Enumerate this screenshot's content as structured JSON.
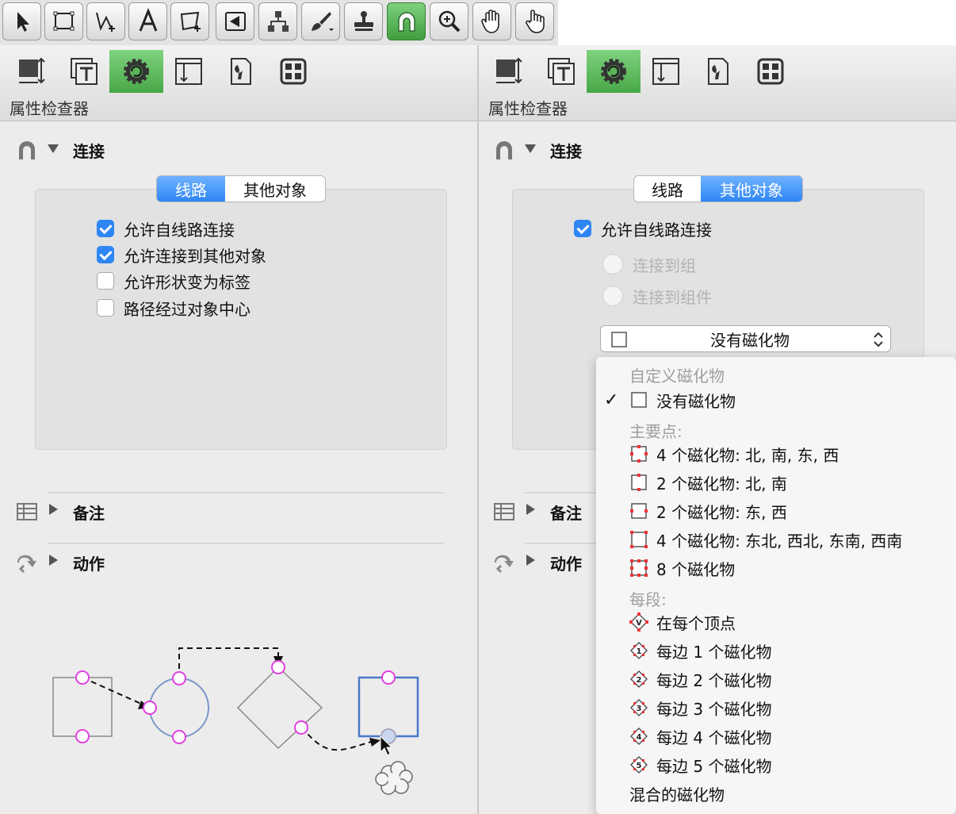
{
  "toolbar": {
    "tools": [
      "selection-tool",
      "rectangle-tool",
      "line-tool",
      "text-tool",
      "shape-tool",
      "arrow-tool",
      "diagram-tool",
      "style-brush-tool",
      "rubber-stamp-tool",
      "magnet-tool",
      "zoom-tool",
      "hand-tool",
      "browse-tool"
    ],
    "active": "magnet-tool"
  },
  "left": {
    "inspector_title": "属性检查器",
    "connect_section": "连接",
    "tabs": [
      "线路",
      "其他对象"
    ],
    "active_tab": "线路",
    "checkboxes": [
      {
        "label": "允许自线路连接",
        "checked": true
      },
      {
        "label": "允许连接到其他对象",
        "checked": true
      },
      {
        "label": "允许形状变为标签",
        "checked": false
      },
      {
        "label": "路径经过对象中心",
        "checked": false
      }
    ],
    "notes_section": "备注",
    "actions_section": "动作"
  },
  "right": {
    "inspector_title": "属性检查器",
    "connect_section": "连接",
    "tabs": [
      "线路",
      "其他对象"
    ],
    "active_tab": "其他对象",
    "checkbox": {
      "label": "允许自线路连接",
      "checked": true
    },
    "radios": [
      "连接到组",
      "连接到组件"
    ],
    "magnet_popup": "没有磁化物",
    "notes_section": "备注",
    "actions_section": "动作"
  },
  "menu": {
    "header_custom": "自定义磁化物",
    "selected": "没有磁化物",
    "header_major": "主要点:",
    "major_items": [
      "4 个磁化物: 北, 南, 东, 西",
      "2 个磁化物: 北, 南",
      "2 个磁化物: 东, 西",
      "4 个磁化物: 东北, 西北, 东南, 西南",
      "8 个磁化物"
    ],
    "header_segment": "每段:",
    "segment_items": [
      "在每个顶点",
      "每边 1 个磁化物",
      "每边 2 个磁化物",
      "每边 3 个磁化物",
      "每边 4 个磁化物",
      "每边 5 个磁化物"
    ],
    "mixed": "混合的磁化物"
  },
  "colors": {
    "accent": "#2f86f5",
    "active_green": "#47a847",
    "magnet_pink": "#e040e0"
  }
}
